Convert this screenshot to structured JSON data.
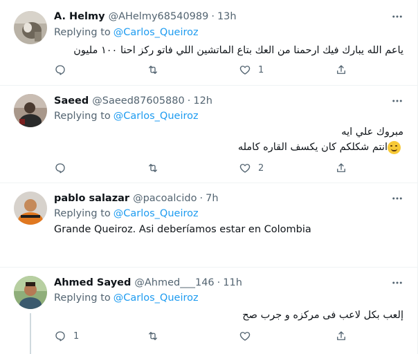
{
  "tweets": [
    {
      "name": "A. Helmy",
      "handle": "@AHelmy68540989",
      "time": "13h",
      "replying_prefix": "Replying to",
      "replying_to": "@Carlos_Queiroz",
      "text_lines": [
        "ياعم الله يبارك فيك ارحمنا من العك بتاع الماتشين اللي فاتو ركز احنا ١٠٠ مليون"
      ],
      "direction": "rtl",
      "replies": "",
      "retweets": "",
      "likes": "1"
    },
    {
      "name": "Saeed",
      "handle": "@Saeed87605880",
      "time": "12h",
      "replying_prefix": "Replying to",
      "replying_to": "@Carlos_Queiroz",
      "text_lines": [
        "مبروك علي ايه",
        "انتم شكلكم كان يكسف القاره كامله"
      ],
      "direction": "rtl",
      "emoji": "sweat-smile-emoji",
      "replies": "",
      "retweets": "",
      "likes": "2"
    },
    {
      "name": "pablo salazar",
      "handle": "@pacoalcido",
      "time": "7h",
      "replying_prefix": "Replying to",
      "replying_to": "@Carlos_Queiroz",
      "text_lines": [
        "Grande Queiroz. Asi deberíamos estar en Colombia"
      ],
      "direction": "ltr",
      "replies": "",
      "retweets": "",
      "likes": ""
    },
    {
      "name": "Ahmed Sayed",
      "handle": "@Ahmed___146",
      "time": "11h",
      "replying_prefix": "Replying to",
      "replying_to": "@Carlos_Queiroz",
      "text_lines": [
        "إلعب بكل لاعب فى مركزه و جرب صح"
      ],
      "direction": "rtl",
      "replies": "1",
      "retweets": "",
      "likes": ""
    }
  ],
  "colors": {
    "link": "#1d9bf0",
    "secondary_text": "#536471",
    "primary_text": "#0f1419",
    "divider": "#eff3f4"
  },
  "icons": {
    "more": "more-icon",
    "reply": "reply-icon",
    "retweet": "retweet-icon",
    "like": "like-icon",
    "share": "share-icon"
  }
}
